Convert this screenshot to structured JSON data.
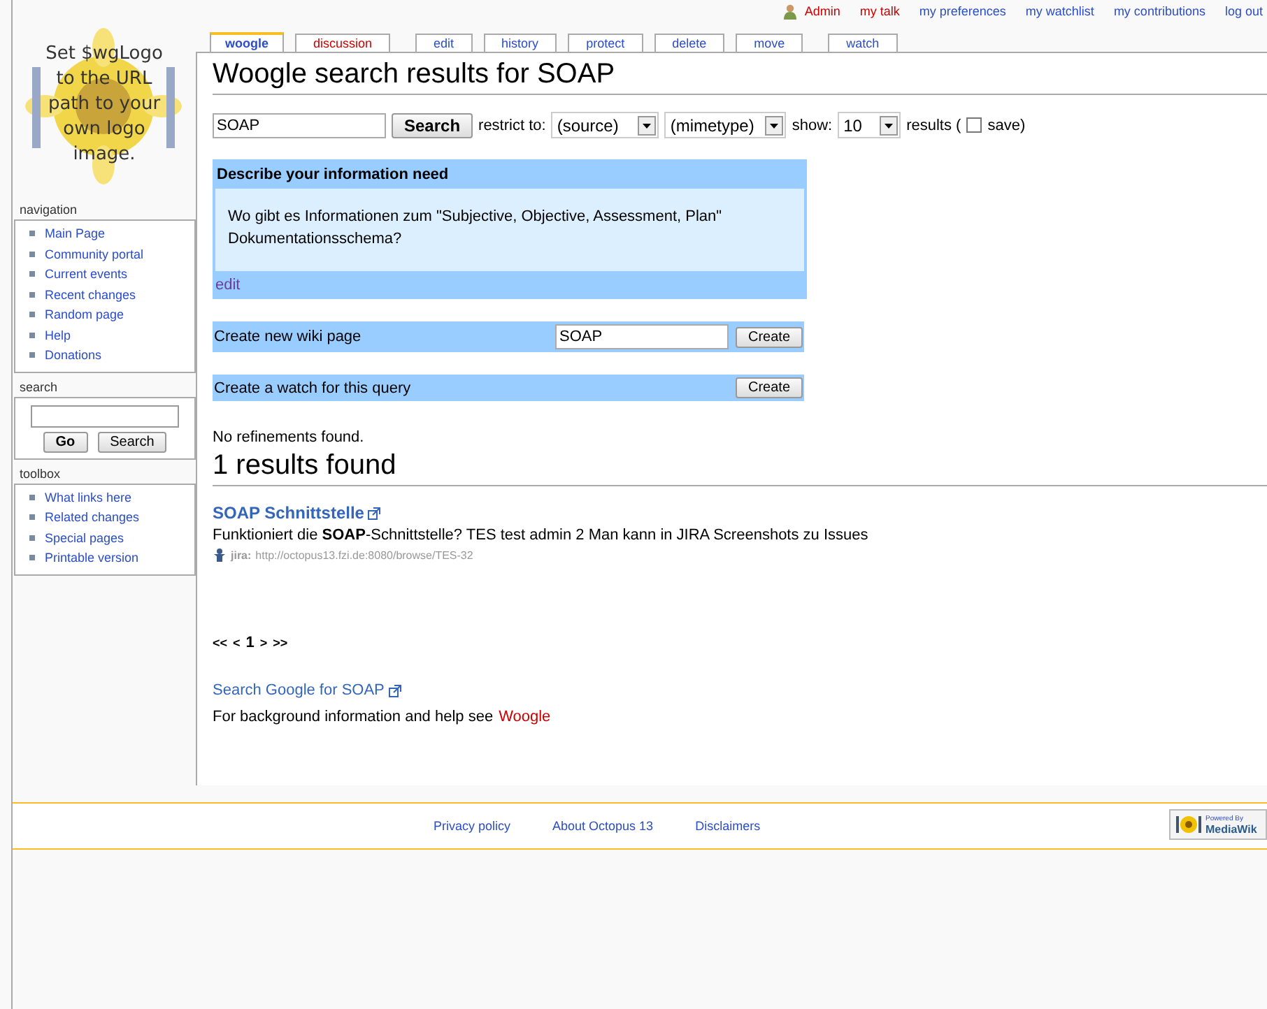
{
  "logo": {
    "text": "Set $wgLogo to the URL path to your own logo image."
  },
  "personal": [
    {
      "label": "Admin",
      "exists": false,
      "kind": "user"
    },
    {
      "label": "my talk",
      "exists": false
    },
    {
      "label": "my preferences",
      "exists": true
    },
    {
      "label": "my watchlist",
      "exists": true
    },
    {
      "label": "my contributions",
      "exists": true
    },
    {
      "label": "log out",
      "exists": true
    }
  ],
  "tab_groups": [
    [
      {
        "label": "woogle",
        "selected": true,
        "exists": true
      },
      {
        "label": "discussion",
        "selected": false,
        "exists": false
      }
    ],
    [
      {
        "label": "edit",
        "selected": false,
        "exists": true
      },
      {
        "label": "history",
        "selected": false,
        "exists": true
      },
      {
        "label": "protect",
        "selected": false,
        "exists": true
      },
      {
        "label": "delete",
        "selected": false,
        "exists": true
      },
      {
        "label": "move",
        "selected": false,
        "exists": true
      }
    ],
    [
      {
        "label": "watch",
        "selected": false,
        "exists": true
      }
    ]
  ],
  "sidebar": [
    {
      "title": "navigation",
      "kind": "links",
      "items": [
        "Main Page",
        "Community portal",
        "Current events",
        "Recent changes",
        "Random page",
        "Help",
        "Donations"
      ]
    },
    {
      "title": "search",
      "kind": "search",
      "buttons": [
        "Go",
        "Search"
      ]
    },
    {
      "title": "toolbox",
      "kind": "links",
      "items": [
        "What links here",
        "Related changes",
        "Special pages",
        "Printable version"
      ]
    }
  ],
  "title": "Woogle search results for SOAP",
  "search_form": {
    "value": "SOAP",
    "button": "Search",
    "restrict_label": "restrict to:",
    "selects": [
      "(source)",
      "(mimetype)"
    ],
    "show_label": "show:",
    "show_value": "10",
    "results_label": "results (",
    "save": {
      "label": "save)",
      "checked": false
    }
  },
  "info_need": {
    "title": "Describe your information need",
    "text": "Wo gibt es Informationen zum \"Subjective, Objective, Assessment, Plan\" Dokumentationsschema?",
    "edit": "edit"
  },
  "create_page": {
    "label": "Create new wiki page",
    "value": "SOAP",
    "button": "Create"
  },
  "create_watch": {
    "label": "Create a watch for this query",
    "button": "Create"
  },
  "refinements": "No refinements found.",
  "results_heading": "1 results found",
  "results": [
    {
      "title": "SOAP Schnittstelle",
      "snippet": "Funktioniert die **SOAP**-Schnittstelle? TES test admin 2 Man kann in JIRA Screenshots zu Issues",
      "source": "jira:",
      "url": "http://octopus13.fzi.de:8080/browse/TES-32"
    }
  ],
  "pager": [
    "<<",
    "<",
    "1",
    ">",
    ">>"
  ],
  "google_link": "Search Google for SOAP",
  "help_text": "For background information and help see",
  "help_link": "Woogle",
  "footer": {
    "links": [
      "Privacy policy",
      "About Octopus 13",
      "Disclaimers"
    ],
    "badge": [
      "Powered By",
      "MediaWik"
    ]
  }
}
